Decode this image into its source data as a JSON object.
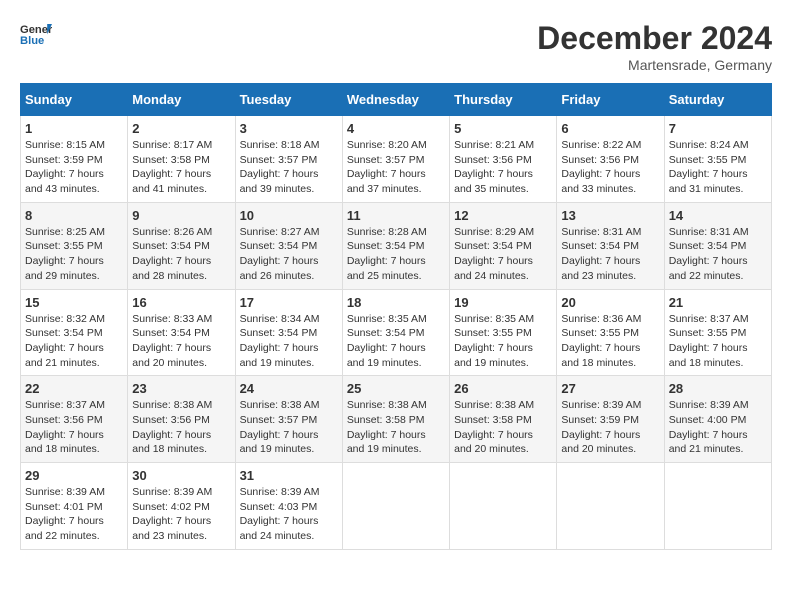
{
  "header": {
    "logo_line1": "General",
    "logo_line2": "Blue",
    "month": "December 2024",
    "location": "Martensrade, Germany"
  },
  "days_of_week": [
    "Sunday",
    "Monday",
    "Tuesday",
    "Wednesday",
    "Thursday",
    "Friday",
    "Saturday"
  ],
  "weeks": [
    [
      {
        "day": "1",
        "lines": [
          "Sunrise: 8:15 AM",
          "Sunset: 3:59 PM",
          "Daylight: 7 hours",
          "and 43 minutes."
        ]
      },
      {
        "day": "2",
        "lines": [
          "Sunrise: 8:17 AM",
          "Sunset: 3:58 PM",
          "Daylight: 7 hours",
          "and 41 minutes."
        ]
      },
      {
        "day": "3",
        "lines": [
          "Sunrise: 8:18 AM",
          "Sunset: 3:57 PM",
          "Daylight: 7 hours",
          "and 39 minutes."
        ]
      },
      {
        "day": "4",
        "lines": [
          "Sunrise: 8:20 AM",
          "Sunset: 3:57 PM",
          "Daylight: 7 hours",
          "and 37 minutes."
        ]
      },
      {
        "day": "5",
        "lines": [
          "Sunrise: 8:21 AM",
          "Sunset: 3:56 PM",
          "Daylight: 7 hours",
          "and 35 minutes."
        ]
      },
      {
        "day": "6",
        "lines": [
          "Sunrise: 8:22 AM",
          "Sunset: 3:56 PM",
          "Daylight: 7 hours",
          "and 33 minutes."
        ]
      },
      {
        "day": "7",
        "lines": [
          "Sunrise: 8:24 AM",
          "Sunset: 3:55 PM",
          "Daylight: 7 hours",
          "and 31 minutes."
        ]
      }
    ],
    [
      {
        "day": "8",
        "lines": [
          "Sunrise: 8:25 AM",
          "Sunset: 3:55 PM",
          "Daylight: 7 hours",
          "and 29 minutes."
        ]
      },
      {
        "day": "9",
        "lines": [
          "Sunrise: 8:26 AM",
          "Sunset: 3:54 PM",
          "Daylight: 7 hours",
          "and 28 minutes."
        ]
      },
      {
        "day": "10",
        "lines": [
          "Sunrise: 8:27 AM",
          "Sunset: 3:54 PM",
          "Daylight: 7 hours",
          "and 26 minutes."
        ]
      },
      {
        "day": "11",
        "lines": [
          "Sunrise: 8:28 AM",
          "Sunset: 3:54 PM",
          "Daylight: 7 hours",
          "and 25 minutes."
        ]
      },
      {
        "day": "12",
        "lines": [
          "Sunrise: 8:29 AM",
          "Sunset: 3:54 PM",
          "Daylight: 7 hours",
          "and 24 minutes."
        ]
      },
      {
        "day": "13",
        "lines": [
          "Sunrise: 8:31 AM",
          "Sunset: 3:54 PM",
          "Daylight: 7 hours",
          "and 23 minutes."
        ]
      },
      {
        "day": "14",
        "lines": [
          "Sunrise: 8:31 AM",
          "Sunset: 3:54 PM",
          "Daylight: 7 hours",
          "and 22 minutes."
        ]
      }
    ],
    [
      {
        "day": "15",
        "lines": [
          "Sunrise: 8:32 AM",
          "Sunset: 3:54 PM",
          "Daylight: 7 hours",
          "and 21 minutes."
        ]
      },
      {
        "day": "16",
        "lines": [
          "Sunrise: 8:33 AM",
          "Sunset: 3:54 PM",
          "Daylight: 7 hours",
          "and 20 minutes."
        ]
      },
      {
        "day": "17",
        "lines": [
          "Sunrise: 8:34 AM",
          "Sunset: 3:54 PM",
          "Daylight: 7 hours",
          "and 19 minutes."
        ]
      },
      {
        "day": "18",
        "lines": [
          "Sunrise: 8:35 AM",
          "Sunset: 3:54 PM",
          "Daylight: 7 hours",
          "and 19 minutes."
        ]
      },
      {
        "day": "19",
        "lines": [
          "Sunrise: 8:35 AM",
          "Sunset: 3:55 PM",
          "Daylight: 7 hours",
          "and 19 minutes."
        ]
      },
      {
        "day": "20",
        "lines": [
          "Sunrise: 8:36 AM",
          "Sunset: 3:55 PM",
          "Daylight: 7 hours",
          "and 18 minutes."
        ]
      },
      {
        "day": "21",
        "lines": [
          "Sunrise: 8:37 AM",
          "Sunset: 3:55 PM",
          "Daylight: 7 hours",
          "and 18 minutes."
        ]
      }
    ],
    [
      {
        "day": "22",
        "lines": [
          "Sunrise: 8:37 AM",
          "Sunset: 3:56 PM",
          "Daylight: 7 hours",
          "and 18 minutes."
        ]
      },
      {
        "day": "23",
        "lines": [
          "Sunrise: 8:38 AM",
          "Sunset: 3:56 PM",
          "Daylight: 7 hours",
          "and 18 minutes."
        ]
      },
      {
        "day": "24",
        "lines": [
          "Sunrise: 8:38 AM",
          "Sunset: 3:57 PM",
          "Daylight: 7 hours",
          "and 19 minutes."
        ]
      },
      {
        "day": "25",
        "lines": [
          "Sunrise: 8:38 AM",
          "Sunset: 3:58 PM",
          "Daylight: 7 hours",
          "and 19 minutes."
        ]
      },
      {
        "day": "26",
        "lines": [
          "Sunrise: 8:38 AM",
          "Sunset: 3:58 PM",
          "Daylight: 7 hours",
          "and 20 minutes."
        ]
      },
      {
        "day": "27",
        "lines": [
          "Sunrise: 8:39 AM",
          "Sunset: 3:59 PM",
          "Daylight: 7 hours",
          "and 20 minutes."
        ]
      },
      {
        "day": "28",
        "lines": [
          "Sunrise: 8:39 AM",
          "Sunset: 4:00 PM",
          "Daylight: 7 hours",
          "and 21 minutes."
        ]
      }
    ],
    [
      {
        "day": "29",
        "lines": [
          "Sunrise: 8:39 AM",
          "Sunset: 4:01 PM",
          "Daylight: 7 hours",
          "and 22 minutes."
        ]
      },
      {
        "day": "30",
        "lines": [
          "Sunrise: 8:39 AM",
          "Sunset: 4:02 PM",
          "Daylight: 7 hours",
          "and 23 minutes."
        ]
      },
      {
        "day": "31",
        "lines": [
          "Sunrise: 8:39 AM",
          "Sunset: 4:03 PM",
          "Daylight: 7 hours",
          "and 24 minutes."
        ]
      },
      {
        "day": "",
        "lines": []
      },
      {
        "day": "",
        "lines": []
      },
      {
        "day": "",
        "lines": []
      },
      {
        "day": "",
        "lines": []
      }
    ]
  ]
}
